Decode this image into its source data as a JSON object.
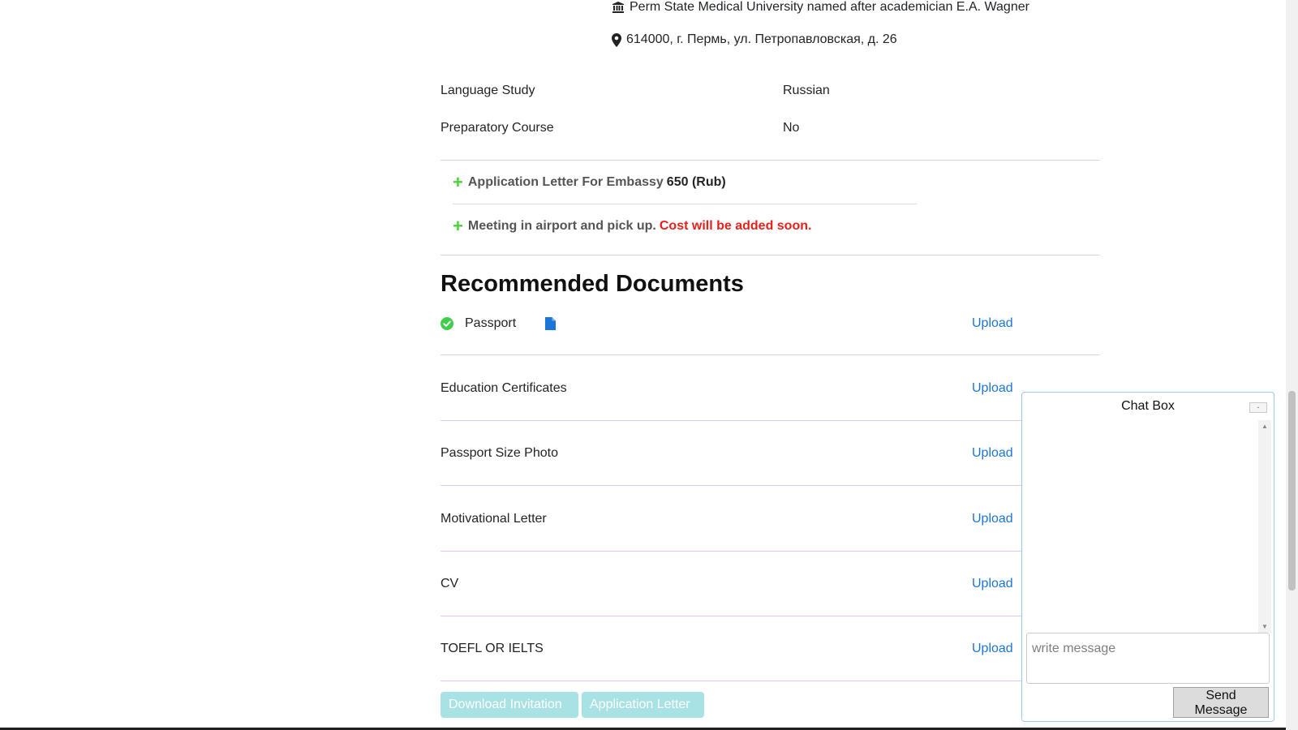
{
  "university": {
    "name": "Perm State Medical University named after academician E.A. Wagner",
    "address": "614000, г. Пермь, ул. Петропавловская, д. 26"
  },
  "details": [
    {
      "label": "Language Study",
      "value": "Russian"
    },
    {
      "label": "Preparatory Course",
      "value": "No"
    }
  ],
  "services": {
    "embassy_letter": {
      "label": "Application Letter For Embassy",
      "price": "650 (Rub)"
    },
    "airport": {
      "label": "Meeting in airport and pick up.",
      "note": "Cost will be added soon."
    }
  },
  "documents": {
    "heading": "Recommended Documents",
    "upload_label": "Upload",
    "items": [
      {
        "label": "Passport",
        "uploaded": true
      },
      {
        "label": "Education Certificates",
        "uploaded": false
      },
      {
        "label": "Passport Size Photo",
        "uploaded": false
      },
      {
        "label": "Motivational Letter",
        "uploaded": false
      },
      {
        "label": "CV",
        "uploaded": false
      },
      {
        "label": "TOEFL OR IELTS",
        "uploaded": false
      }
    ]
  },
  "actions": {
    "download_invitation": "Download Invitation",
    "application_letter": "Application Letter"
  },
  "chat": {
    "title": "Chat Box",
    "minimize": "-",
    "placeholder": "write message",
    "send_label": "Send Message"
  },
  "colors": {
    "link": "#1c75d9",
    "plus": "#4cd137",
    "warning": "#e8201c",
    "divider": "#e6c8ea",
    "button_disabled": "#a8e2e5"
  }
}
